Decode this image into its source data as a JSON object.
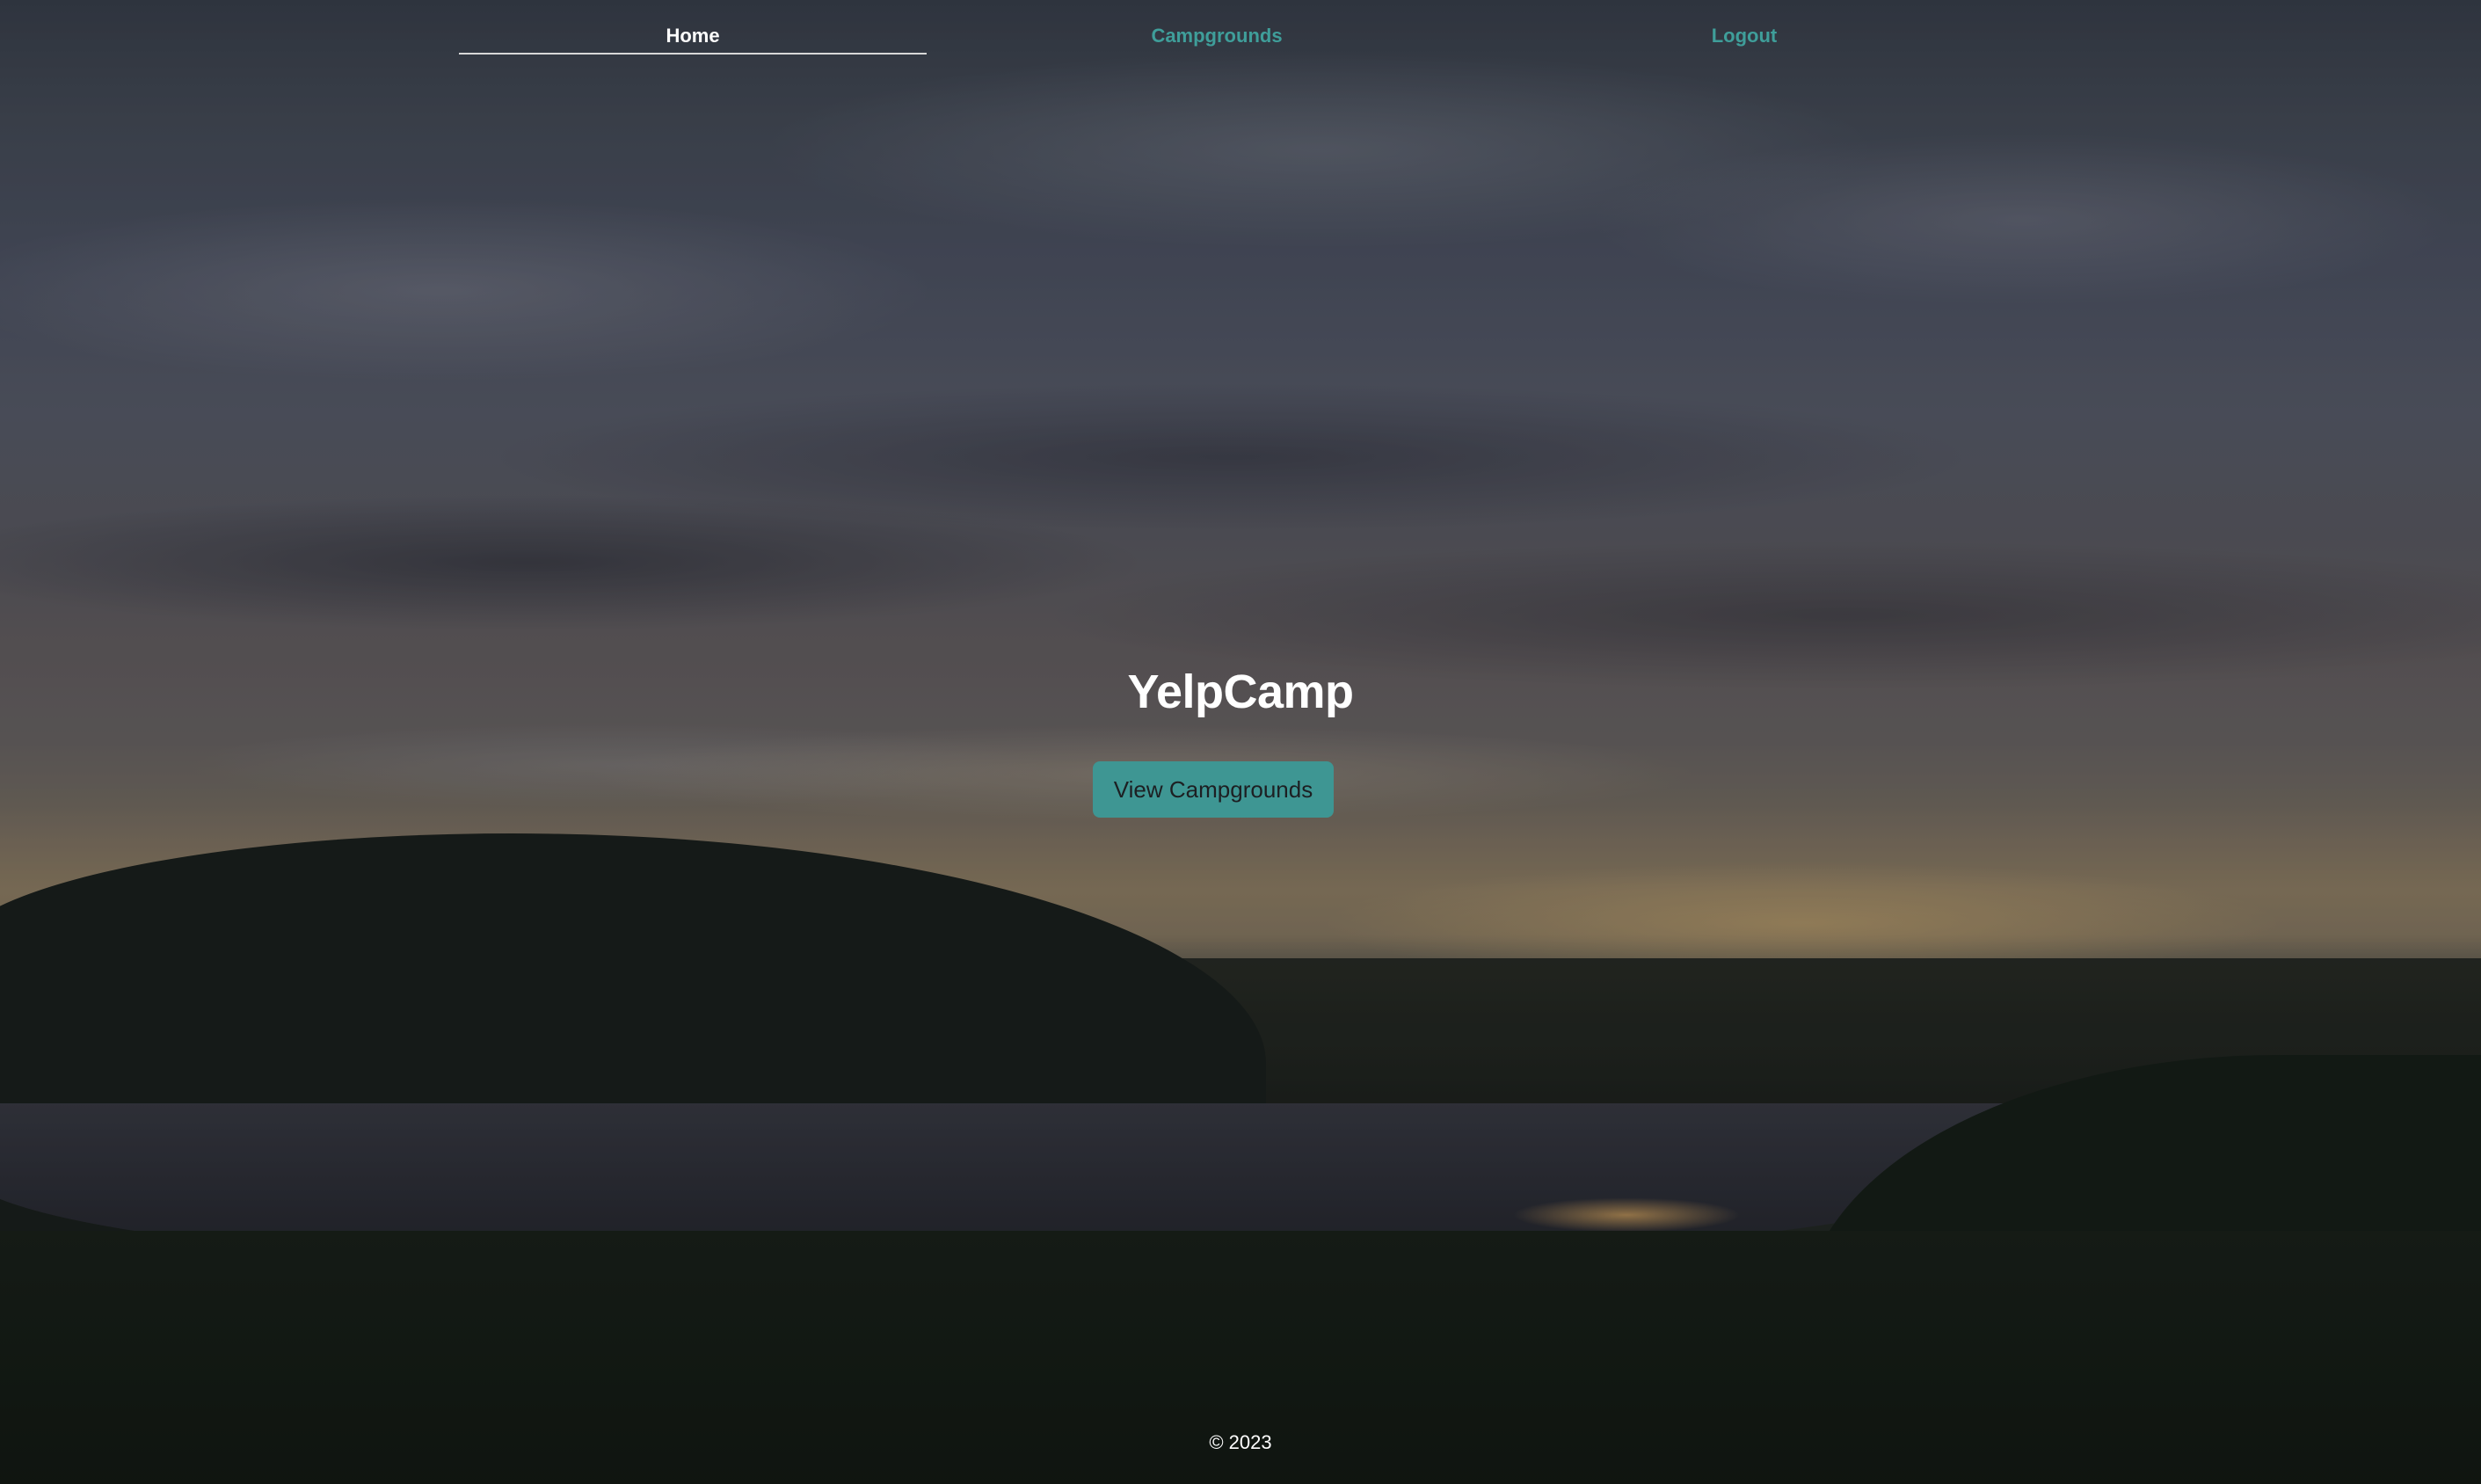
{
  "nav": {
    "home_label": "Home",
    "campgrounds_label": "Campgrounds",
    "logout_label": "Logout"
  },
  "hero": {
    "title": "YelpCamp",
    "button_label": "View Campgrounds"
  },
  "footer": {
    "copyright": "© 2023"
  },
  "colors": {
    "accent": "#3e9693",
    "nav_link": "#3f9e9a",
    "text": "#ffffff"
  }
}
